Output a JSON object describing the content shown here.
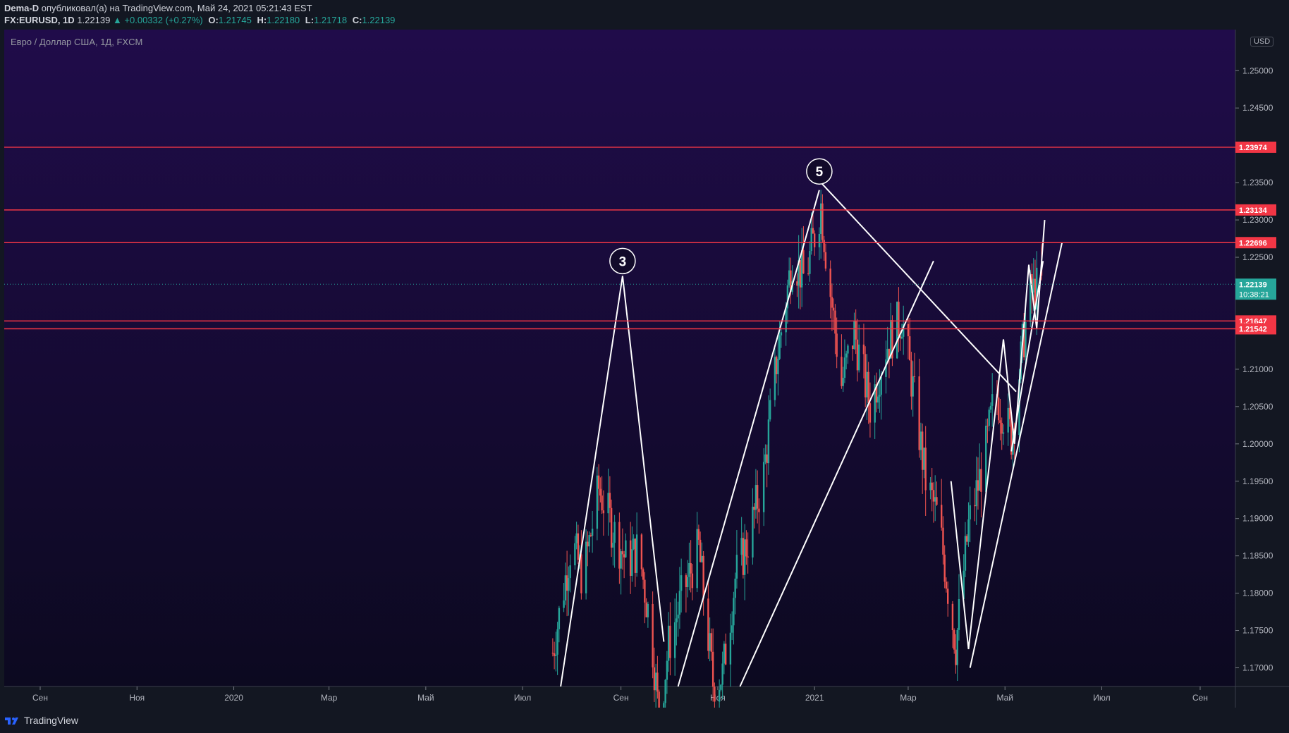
{
  "header": {
    "author": "Dema-D",
    "published_text": " опубликовал(а) на TradingView.com, Май 24, 2021 05:21:43 EST",
    "symbol": "FX:EURUSD, 1D",
    "last": "1.22139",
    "change": "▲ +0.00332 (+0.27%)",
    "o_label": "O:",
    "o_val": "1.21745",
    "h_label": "H:",
    "h_val": "1.22180",
    "l_label": "L:",
    "l_val": "1.21718",
    "c_label": "C:",
    "c_val": "1.22139"
  },
  "chart_title": "Евро / Доллар США, 1Д, FXCM",
  "currency": "USD",
  "footer": {
    "brand": "TradingView"
  },
  "colors": {
    "background": "#131722",
    "bull": "#26a69a",
    "bear": "#ef5350",
    "level_line": "#f23645",
    "drawing": "#ffffff"
  },
  "chart_data": {
    "type": "candlestick",
    "symbol": "EURUSD",
    "timeframe": "1D",
    "ylim": [
      1.1675,
      1.2555
    ],
    "y_ticks": [
      1.25,
      1.245,
      1.235,
      1.23,
      1.225,
      1.21,
      1.205,
      1.2,
      1.195,
      1.19,
      1.185,
      1.18,
      1.175,
      1.17
    ],
    "y_tick_labels": [
      "1.25000",
      "1.24500",
      "1.23500",
      "1.23000",
      "1.22500",
      "1.21000",
      "1.20500",
      "1.20000",
      "1.19500",
      "1.19000",
      "1.18500",
      "1.18000",
      "1.17500",
      "1.17000"
    ],
    "x_ticks": [
      {
        "label": "Сен",
        "x": "2019-09-01"
      },
      {
        "label": "Ноя",
        "x": "2019-11-01"
      },
      {
        "label": "2020",
        "x": "2020-01-01"
      },
      {
        "label": "Мар",
        "x": "2020-03-01"
      },
      {
        "label": "Май",
        "x": "2020-05-01"
      },
      {
        "label": "Июл",
        "x": "2020-07-01"
      },
      {
        "label": "Сен",
        "x": "2020-09-01"
      },
      {
        "label": "Ноя",
        "x": "2020-11-01"
      },
      {
        "label": "2021",
        "x": "2021-01-01"
      },
      {
        "label": "Мар",
        "x": "2021-03-01"
      },
      {
        "label": "Май",
        "x": "2021-05-01"
      },
      {
        "label": "Июл",
        "x": "2021-07-01"
      },
      {
        "label": "Сен",
        "x": "2021-09-01"
      }
    ],
    "horizontal_levels": [
      {
        "value": 1.23974,
        "label": "1.23974"
      },
      {
        "value": 1.23134,
        "label": "1.23134"
      },
      {
        "value": 1.22696,
        "label": "1.22696"
      },
      {
        "value": 1.21647,
        "label": "1.21647"
      },
      {
        "value": 1.21542,
        "label": "1.21542"
      }
    ],
    "current_price": {
      "value": 1.22139,
      "label": "1.22139",
      "countdown": "10:38:21"
    },
    "price_path": [
      [
        "2020-07-20",
        1.172
      ],
      [
        "2020-08-01",
        1.187
      ],
      [
        "2020-08-08",
        1.182
      ],
      [
        "2020-08-18",
        1.194
      ],
      [
        "2020-08-28",
        1.188
      ],
      [
        "2020-09-05",
        1.184
      ],
      [
        "2020-09-12",
        1.186
      ],
      [
        "2020-09-20",
        1.175
      ],
      [
        "2020-09-25",
        1.163
      ],
      [
        "2020-10-01",
        1.173
      ],
      [
        "2020-10-10",
        1.18
      ],
      [
        "2020-10-20",
        1.186
      ],
      [
        "2020-10-29",
        1.168
      ],
      [
        "2020-11-04",
        1.169
      ],
      [
        "2020-11-12",
        1.182
      ],
      [
        "2020-11-20",
        1.187
      ],
      [
        "2020-11-30",
        1.196
      ],
      [
        "2020-12-08",
        1.211
      ],
      [
        "2020-12-18",
        1.225
      ],
      [
        "2020-12-26",
        1.222
      ],
      [
        "2021-01-05",
        1.232
      ],
      [
        "2021-01-10",
        1.222
      ],
      [
        "2021-01-18",
        1.208
      ],
      [
        "2021-01-26",
        1.215
      ],
      [
        "2021-02-05",
        1.205
      ],
      [
        "2021-02-15",
        1.213
      ],
      [
        "2021-02-25",
        1.217
      ],
      [
        "2021-03-05",
        1.206
      ],
      [
        "2021-03-12",
        1.195
      ],
      [
        "2021-03-20",
        1.19
      ],
      [
        "2021-03-31",
        1.173
      ],
      [
        "2021-04-08",
        1.189
      ],
      [
        "2021-04-18",
        1.198
      ],
      [
        "2021-04-25",
        1.207
      ],
      [
        "2021-05-05",
        1.201
      ],
      [
        "2021-05-12",
        1.213
      ],
      [
        "2021-05-17",
        1.22
      ],
      [
        "2021-05-24",
        1.2214
      ]
    ],
    "annotations": [
      {
        "label": "3",
        "x": "2020-09-02",
        "y": 1.2245
      },
      {
        "label": "5",
        "x": "2021-01-04",
        "y": 1.2365
      }
    ]
  }
}
